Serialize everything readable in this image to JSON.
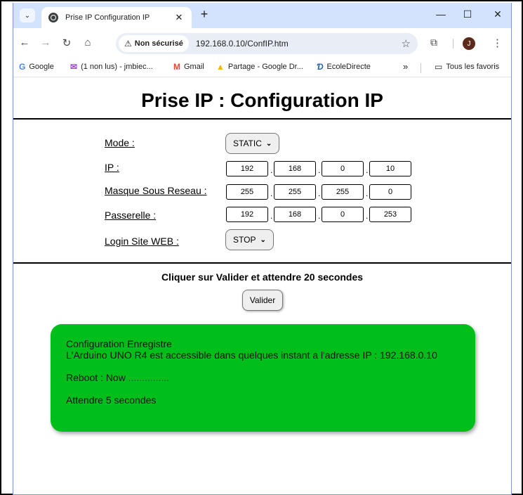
{
  "browser": {
    "tab": {
      "title": "Prise IP Configuration IP"
    },
    "address_bar": {
      "security_label": "Non sécurisé",
      "url": "192.168.0.10/ConfIP.htm"
    },
    "profile_initial": "J",
    "bookmarks": [
      {
        "label": "Google",
        "icon": "google-icon",
        "color": "#4285f4"
      },
      {
        "label": "(1 non lus) - jmbiec...",
        "icon": "mail-icon",
        "color": "#a142f4"
      },
      {
        "label": "Gmail",
        "icon": "gmail-icon",
        "color": "#ea4335"
      },
      {
        "label": "Partage - Google Dr...",
        "icon": "drive-icon",
        "color": "#f4b400"
      },
      {
        "label": "EcoleDirecte",
        "icon": "ecoledirecte-icon",
        "color": "#1a5fb4"
      }
    ],
    "all_bookmarks_label": "Tous les favoris"
  },
  "page": {
    "title": "Prise IP : Configuration IP",
    "form": {
      "mode": {
        "label": "Mode :",
        "value": "STATIC"
      },
      "ip": {
        "label": "IP :",
        "octets": [
          "192",
          "168",
          "0",
          "10"
        ]
      },
      "mask": {
        "label": "Masque Sous Reseau :",
        "octets": [
          "255",
          "255",
          "255",
          "0"
        ]
      },
      "gateway": {
        "label": "Passerelle :",
        "octets": [
          "192",
          "168",
          "0",
          "253"
        ]
      },
      "login": {
        "label": "Login Site WEB :",
        "value": "STOP"
      }
    },
    "instruction": "Cliquer sur Valider et attendre 20 secondes",
    "submit_label": "Valider",
    "status": {
      "line1": "Configuration Enregistre",
      "line2": "L'Arduino UNO R4 est accessible dans quelques instant a l'adresse IP : 192.168.0.10",
      "reboot_label": "Reboot : Now",
      "reboot_dots": "...............",
      "wait": "Attendre 5 secondes",
      "color": "#00bf1a"
    }
  }
}
